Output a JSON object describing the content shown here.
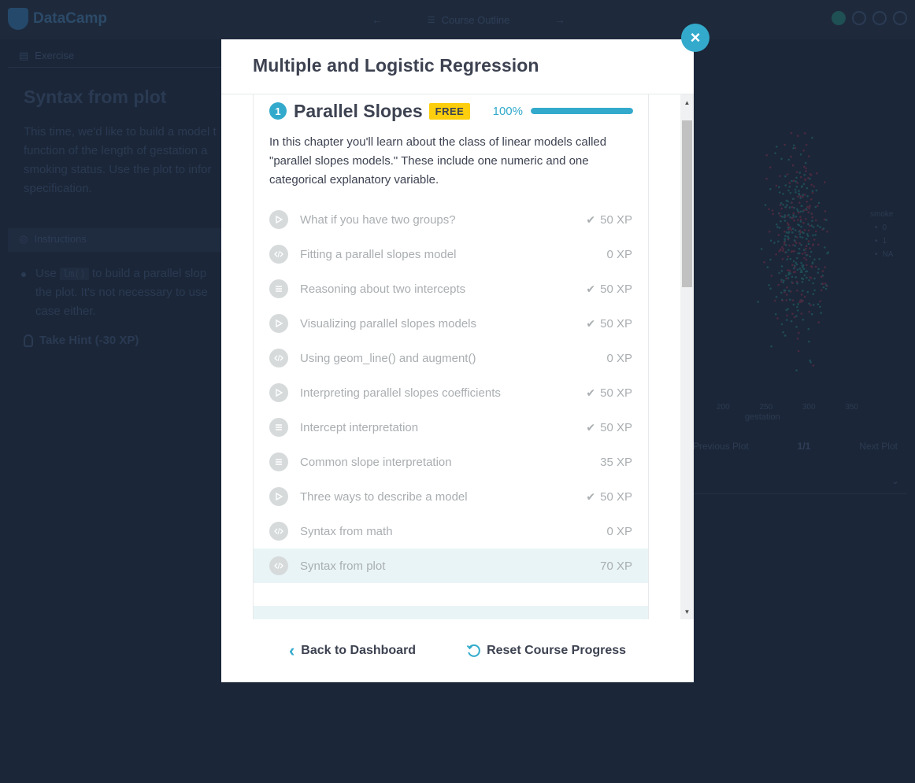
{
  "app": {
    "logo": "DataCamp",
    "course_outline": "Course Outline",
    "exercise_tab": "Exercise",
    "exercise_title": "Syntax from plot",
    "exercise_desc": "This time, we'd like to build a model t function of the length of gestation a smoking status. Use the plot to infor specification.",
    "instructions_tab": "Instructions",
    "instruction_use": "Use",
    "instruction_code": "lm()",
    "instruction_rest": "to build a parallel slop the plot. It's not necessary to use case either.",
    "hint": "Take Hint (-30 XP)",
    "plot_legend_title": "smoke",
    "plot_legend_items": [
      "0",
      "1",
      "NA"
    ],
    "plot_xticks": [
      "200",
      "250",
      "300",
      "350"
    ],
    "plot_xlabel": "gestation",
    "plot_prev": "Previous Plot",
    "plot_page": "1/1",
    "plot_next": "Next Plot"
  },
  "modal": {
    "title": "Multiple and Logistic Regression",
    "close_label": "×",
    "chapter": {
      "number": "1",
      "title": "Parallel Slopes",
      "badge": "FREE",
      "progress_label": "100%",
      "progress": 1.0,
      "description": "In this chapter you'll learn about the class of linear models called \"parallel slopes models.\" These include one numeric and one categorical explanatory variable."
    },
    "exercises": [
      {
        "type": "video",
        "label": "What if you have two groups?",
        "xp": "50 XP",
        "done": true
      },
      {
        "type": "code",
        "label": "Fitting a parallel slopes model",
        "xp": "0 XP",
        "done": false
      },
      {
        "type": "mc",
        "label": "Reasoning about two intercepts",
        "xp": "50 XP",
        "done": true
      },
      {
        "type": "video",
        "label": "Visualizing parallel slopes models",
        "xp": "50 XP",
        "done": true
      },
      {
        "type": "code",
        "label": "Using geom_line() and augment()",
        "xp": "0 XP",
        "done": false
      },
      {
        "type": "video",
        "label": "Interpreting parallel slopes coefficients",
        "xp": "50 XP",
        "done": true
      },
      {
        "type": "mc",
        "label": "Intercept interpretation",
        "xp": "50 XP",
        "done": true
      },
      {
        "type": "mc",
        "label": "Common slope interpretation",
        "xp": "35 XP",
        "done": false
      },
      {
        "type": "video",
        "label": "Three ways to describe a model",
        "xp": "50 XP",
        "done": true
      },
      {
        "type": "code",
        "label": "Syntax from math",
        "xp": "0 XP",
        "done": false
      },
      {
        "type": "code",
        "label": "Syntax from plot",
        "xp": "70 XP",
        "done": false,
        "current": true
      }
    ],
    "footer": {
      "back": "Back to Dashboard",
      "reset": "Reset Course Progress"
    }
  },
  "colors": {
    "accent": "#33aacc",
    "badge": "#fcce0d",
    "backdrop": "#1b2638",
    "muted_text": "#a9aeb1"
  }
}
